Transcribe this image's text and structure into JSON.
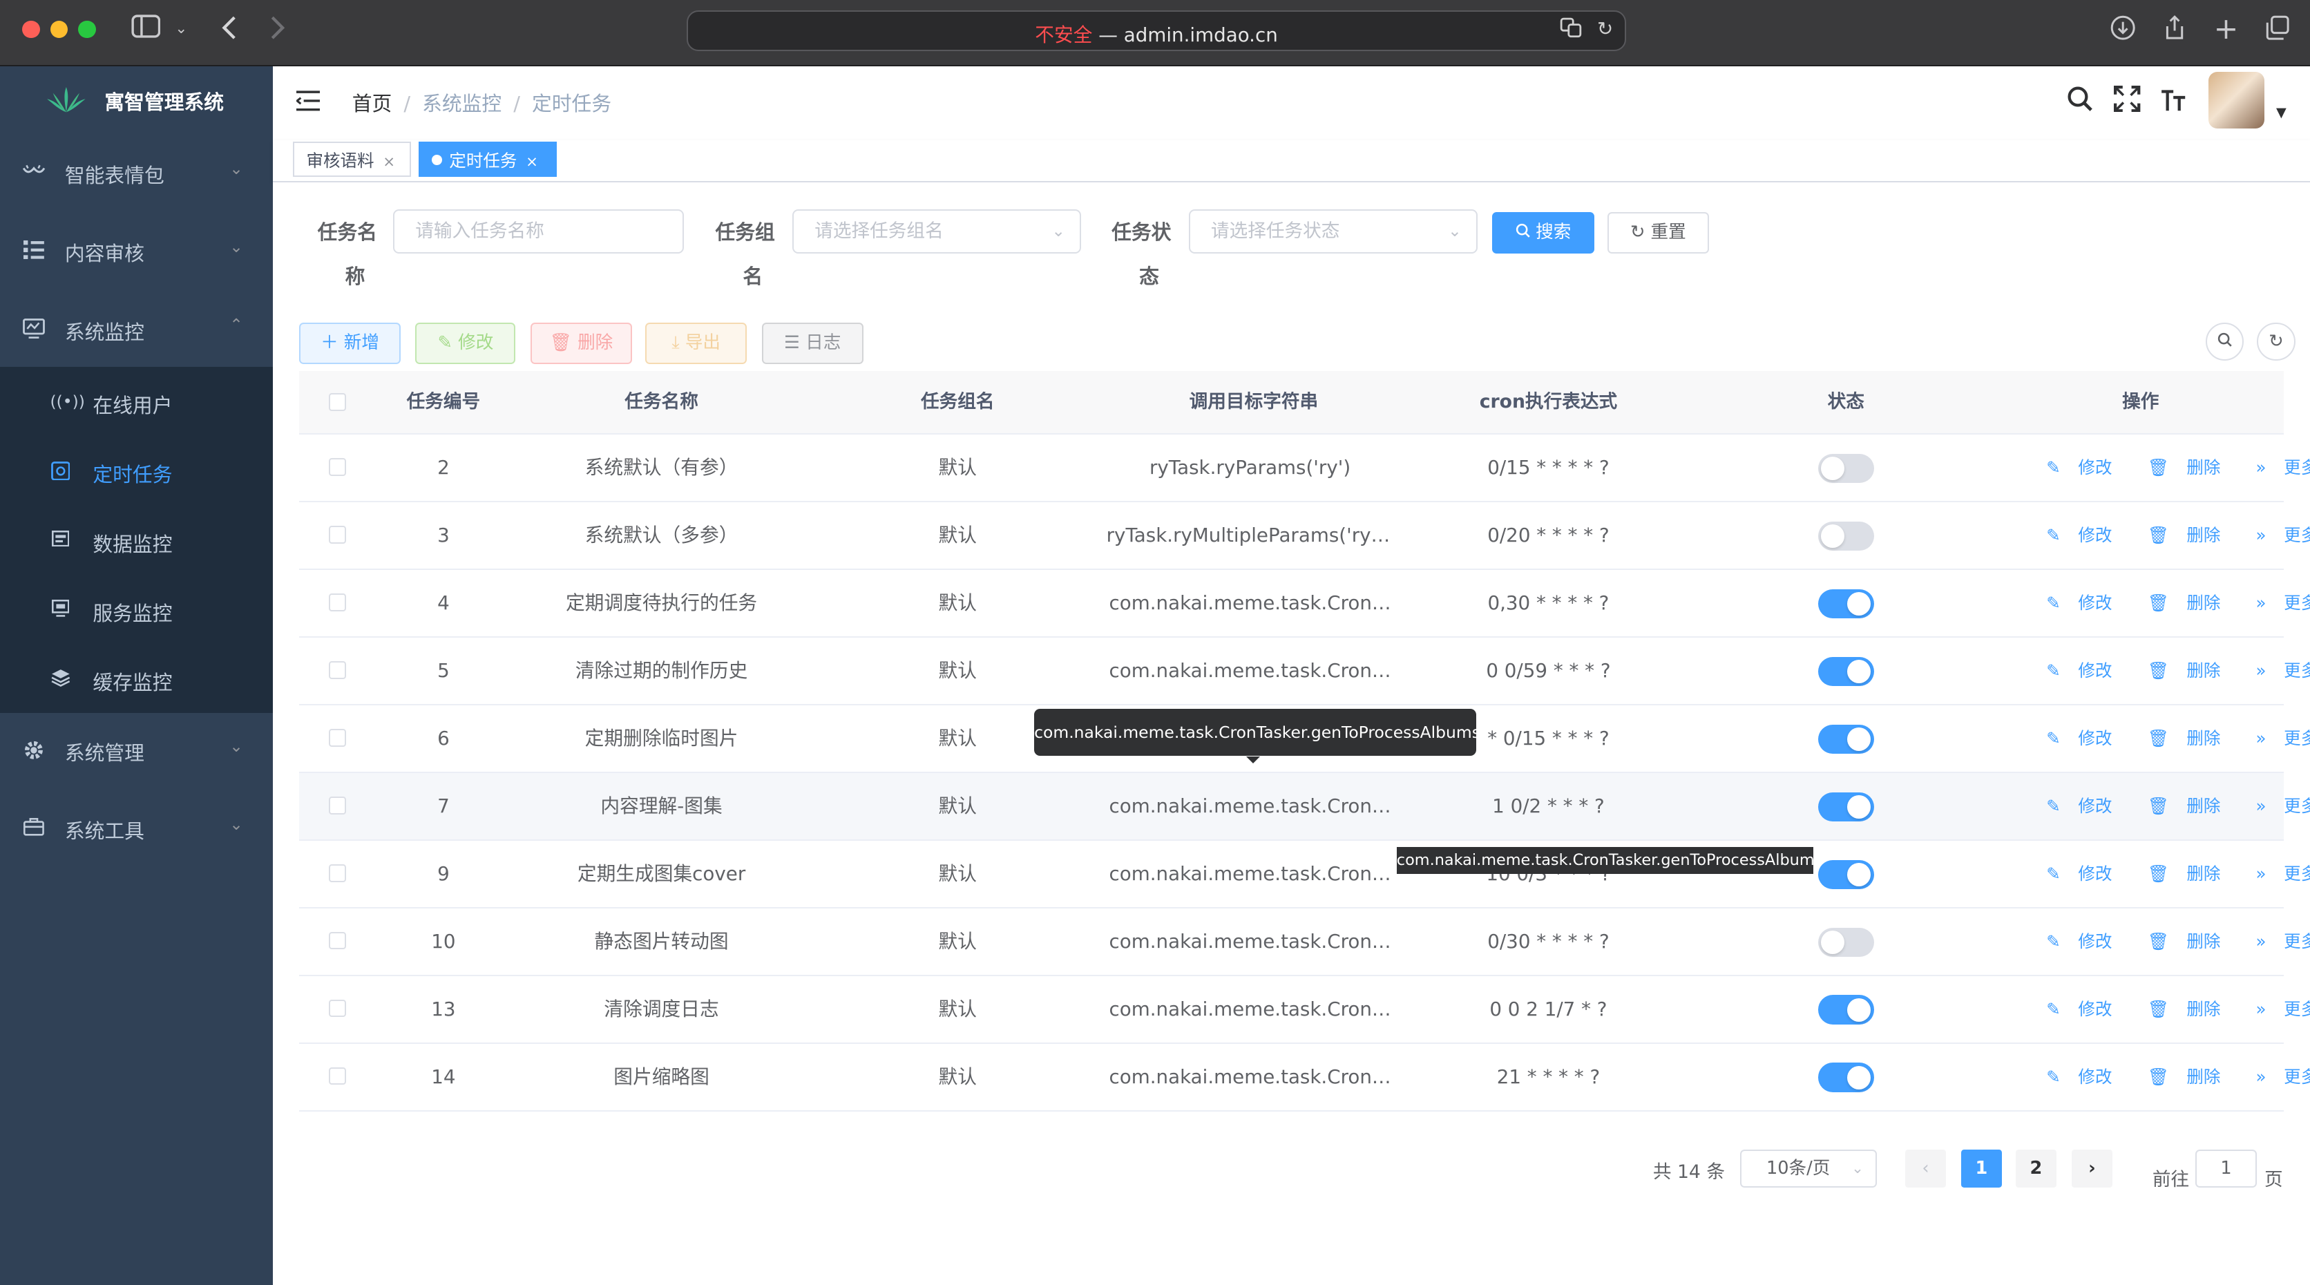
{
  "browser": {
    "insecure_label": "不安全",
    "url_sep": " — ",
    "url": "admin.imdao.cn"
  },
  "sidebar": {
    "app_title": "寓智管理系统",
    "menu": [
      {
        "label": "智能表情包",
        "icon": "emoji-icon"
      },
      {
        "label": "内容审核",
        "icon": "list-icon"
      },
      {
        "label": "系统监控",
        "icon": "monitor-icon",
        "expanded": true
      },
      {
        "label": "系统管理",
        "icon": "gear-icon"
      },
      {
        "label": "系统工具",
        "icon": "toolbox-icon"
      }
    ],
    "submenu": [
      {
        "label": "在线用户",
        "icon": "online-icon"
      },
      {
        "label": "定时任务",
        "icon": "job-icon",
        "active": true
      },
      {
        "label": "数据监控",
        "icon": "data-icon"
      },
      {
        "label": "服务监控",
        "icon": "server-icon"
      },
      {
        "label": "缓存监控",
        "icon": "cache-icon"
      }
    ]
  },
  "navbar": {
    "breadcrumb": [
      "首页",
      "系统监控",
      "定时任务"
    ],
    "sep": "/"
  },
  "tags": [
    {
      "label": "审核语料",
      "active": false
    },
    {
      "label": "定时任务",
      "active": true
    }
  ],
  "search": {
    "job_name_label": [
      "任务名",
      "称"
    ],
    "job_name_placeholder": "请输入任务名称",
    "job_group_label": [
      "任务组",
      "名"
    ],
    "job_group_placeholder": "请选择任务组名",
    "status_label": [
      "任务状",
      "态"
    ],
    "status_placeholder": "请选择任务状态",
    "search_button": "搜索",
    "reset_button": "重置"
  },
  "toolbar": {
    "add": "新增",
    "edit": "修改",
    "delete": "删除",
    "export": "导出",
    "log": "日志"
  },
  "table": {
    "columns": [
      "任务编号",
      "任务名称",
      "任务组名",
      "调用目标字符串",
      "cron执行表达式",
      "状态",
      "操作"
    ],
    "rows": [
      {
        "id": "2",
        "name": "系统默认（有参）",
        "group": "默认",
        "target": "ryTask.ryParams('ry')",
        "cron": "0/15 * * * * ?",
        "enabled": false
      },
      {
        "id": "3",
        "name": "系统默认（多参）",
        "group": "默认",
        "target": "ryTask.ryMultipleParams('ry'…",
        "cron": "0/20 * * * * ?",
        "enabled": false
      },
      {
        "id": "4",
        "name": "定期调度待执行的任务",
        "group": "默认",
        "target": "com.nakai.meme.task.Cron…",
        "cron": "0,30 * * * * ?",
        "enabled": true
      },
      {
        "id": "5",
        "name": "清除过期的制作历史",
        "group": "默认",
        "target": "com.nakai.meme.task.Cron…",
        "cron": "0 0/59 * * * ?",
        "enabled": true
      },
      {
        "id": "6",
        "name": "定期删除临时图片",
        "group": "默认",
        "target": "com.nakai.meme.task.Cron…",
        "cron": "* 0/15 * * * ?",
        "enabled": true
      },
      {
        "id": "7",
        "name": "内容理解-图集",
        "group": "默认",
        "target": "com.nakai.meme.task.Cron…",
        "cron": "1 0/2 * * * ?",
        "enabled": true
      },
      {
        "id": "9",
        "name": "定期生成图集cover",
        "group": "默认",
        "target": "com.nakai.meme.task.Cron…",
        "cron": "10 0/3 * * * ?",
        "enabled": true
      },
      {
        "id": "10",
        "name": "静态图片转动图",
        "group": "默认",
        "target": "com.nakai.meme.task.Cron…",
        "cron": "0/30 * * * * ?",
        "enabled": false
      },
      {
        "id": "13",
        "name": "清除调度日志",
        "group": "默认",
        "target": "com.nakai.meme.task.Cron…",
        "cron": "0 0 2 1/7 * ?",
        "enabled": true
      },
      {
        "id": "14",
        "name": "图片缩略图",
        "group": "默认",
        "target": "com.nakai.meme.task.Cron…",
        "cron": "21 * * * * ?",
        "enabled": true
      }
    ],
    "row_actions": {
      "edit": "修改",
      "delete": "删除",
      "more": "更多"
    }
  },
  "tooltips": {
    "row6_target": "com.nakai.meme.task.CronTasker.genToProcessAlbums",
    "row9_cron": "com.nakai.meme.task.CronTasker.genToProcessAlbums"
  },
  "pagination": {
    "total": "共 14 条",
    "page_size": "10条/页",
    "pages": [
      "1",
      "2"
    ],
    "current": "1",
    "goto_prefix": "前往",
    "goto_value": "1",
    "goto_suffix": "页"
  },
  "colors": {
    "sidebar_bg": "#304156",
    "submenu_bg": "#1f2d3d",
    "primary": "#409eff"
  }
}
